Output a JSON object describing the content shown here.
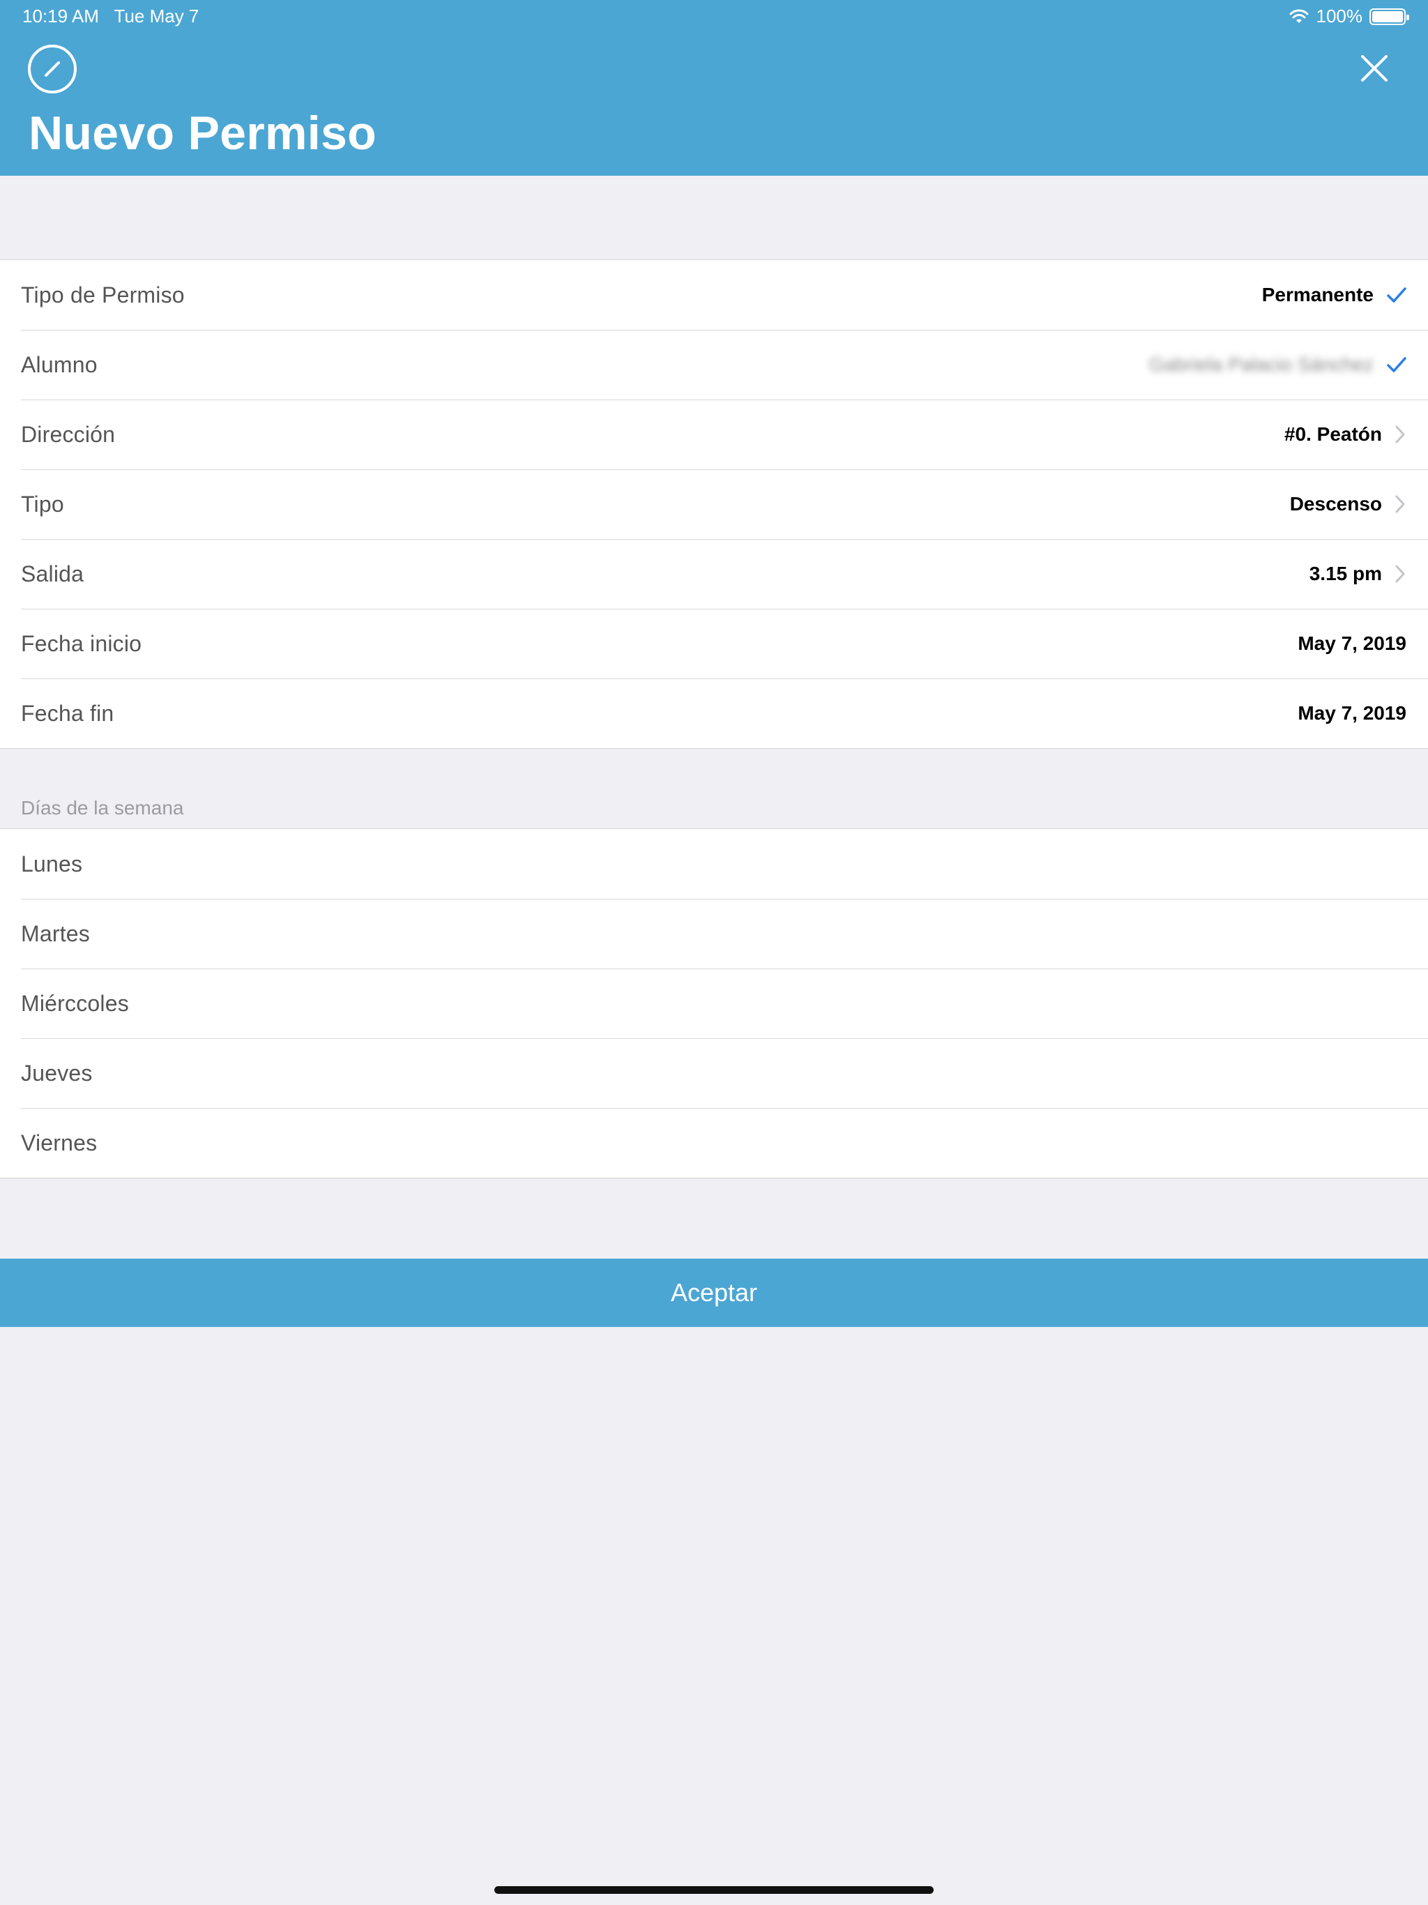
{
  "status_bar": {
    "time": "10:19 AM",
    "date": "Tue May 7",
    "battery": "100%"
  },
  "header": {
    "title": "Nuevo Permiso",
    "logo_icon": "slash-circle-icon",
    "close_icon": "close-icon",
    "color": "#4ba6d3"
  },
  "form": {
    "rows": [
      {
        "label": "Tipo de Permiso",
        "value": "Permanente",
        "accessory": "checkmark"
      },
      {
        "label": "Alumno",
        "value": "Gabriela Palacio Sánchez",
        "accessory": "checkmark"
      },
      {
        "label": "Dirección",
        "value": "#0. Peatón",
        "accessory": "chevron"
      },
      {
        "label": "Tipo",
        "value": "Descenso",
        "accessory": "chevron"
      },
      {
        "label": "Salida",
        "value": "3.15 pm",
        "accessory": "chevron"
      },
      {
        "label": "Fecha inicio",
        "value": "May 7, 2019",
        "accessory": "none"
      },
      {
        "label": "Fecha fin",
        "value": "May 7, 2019",
        "accessory": "none"
      }
    ]
  },
  "weekdays": {
    "caption": "Días de la semana",
    "days": [
      "Lunes",
      "Martes",
      "Miérccoles",
      "Jueves",
      "Viernes"
    ]
  },
  "accept_button": {
    "label": "Aceptar"
  },
  "colors": {
    "accent": "#4ba6d3",
    "check": "#2a7ee8",
    "background": "#efeff4"
  }
}
